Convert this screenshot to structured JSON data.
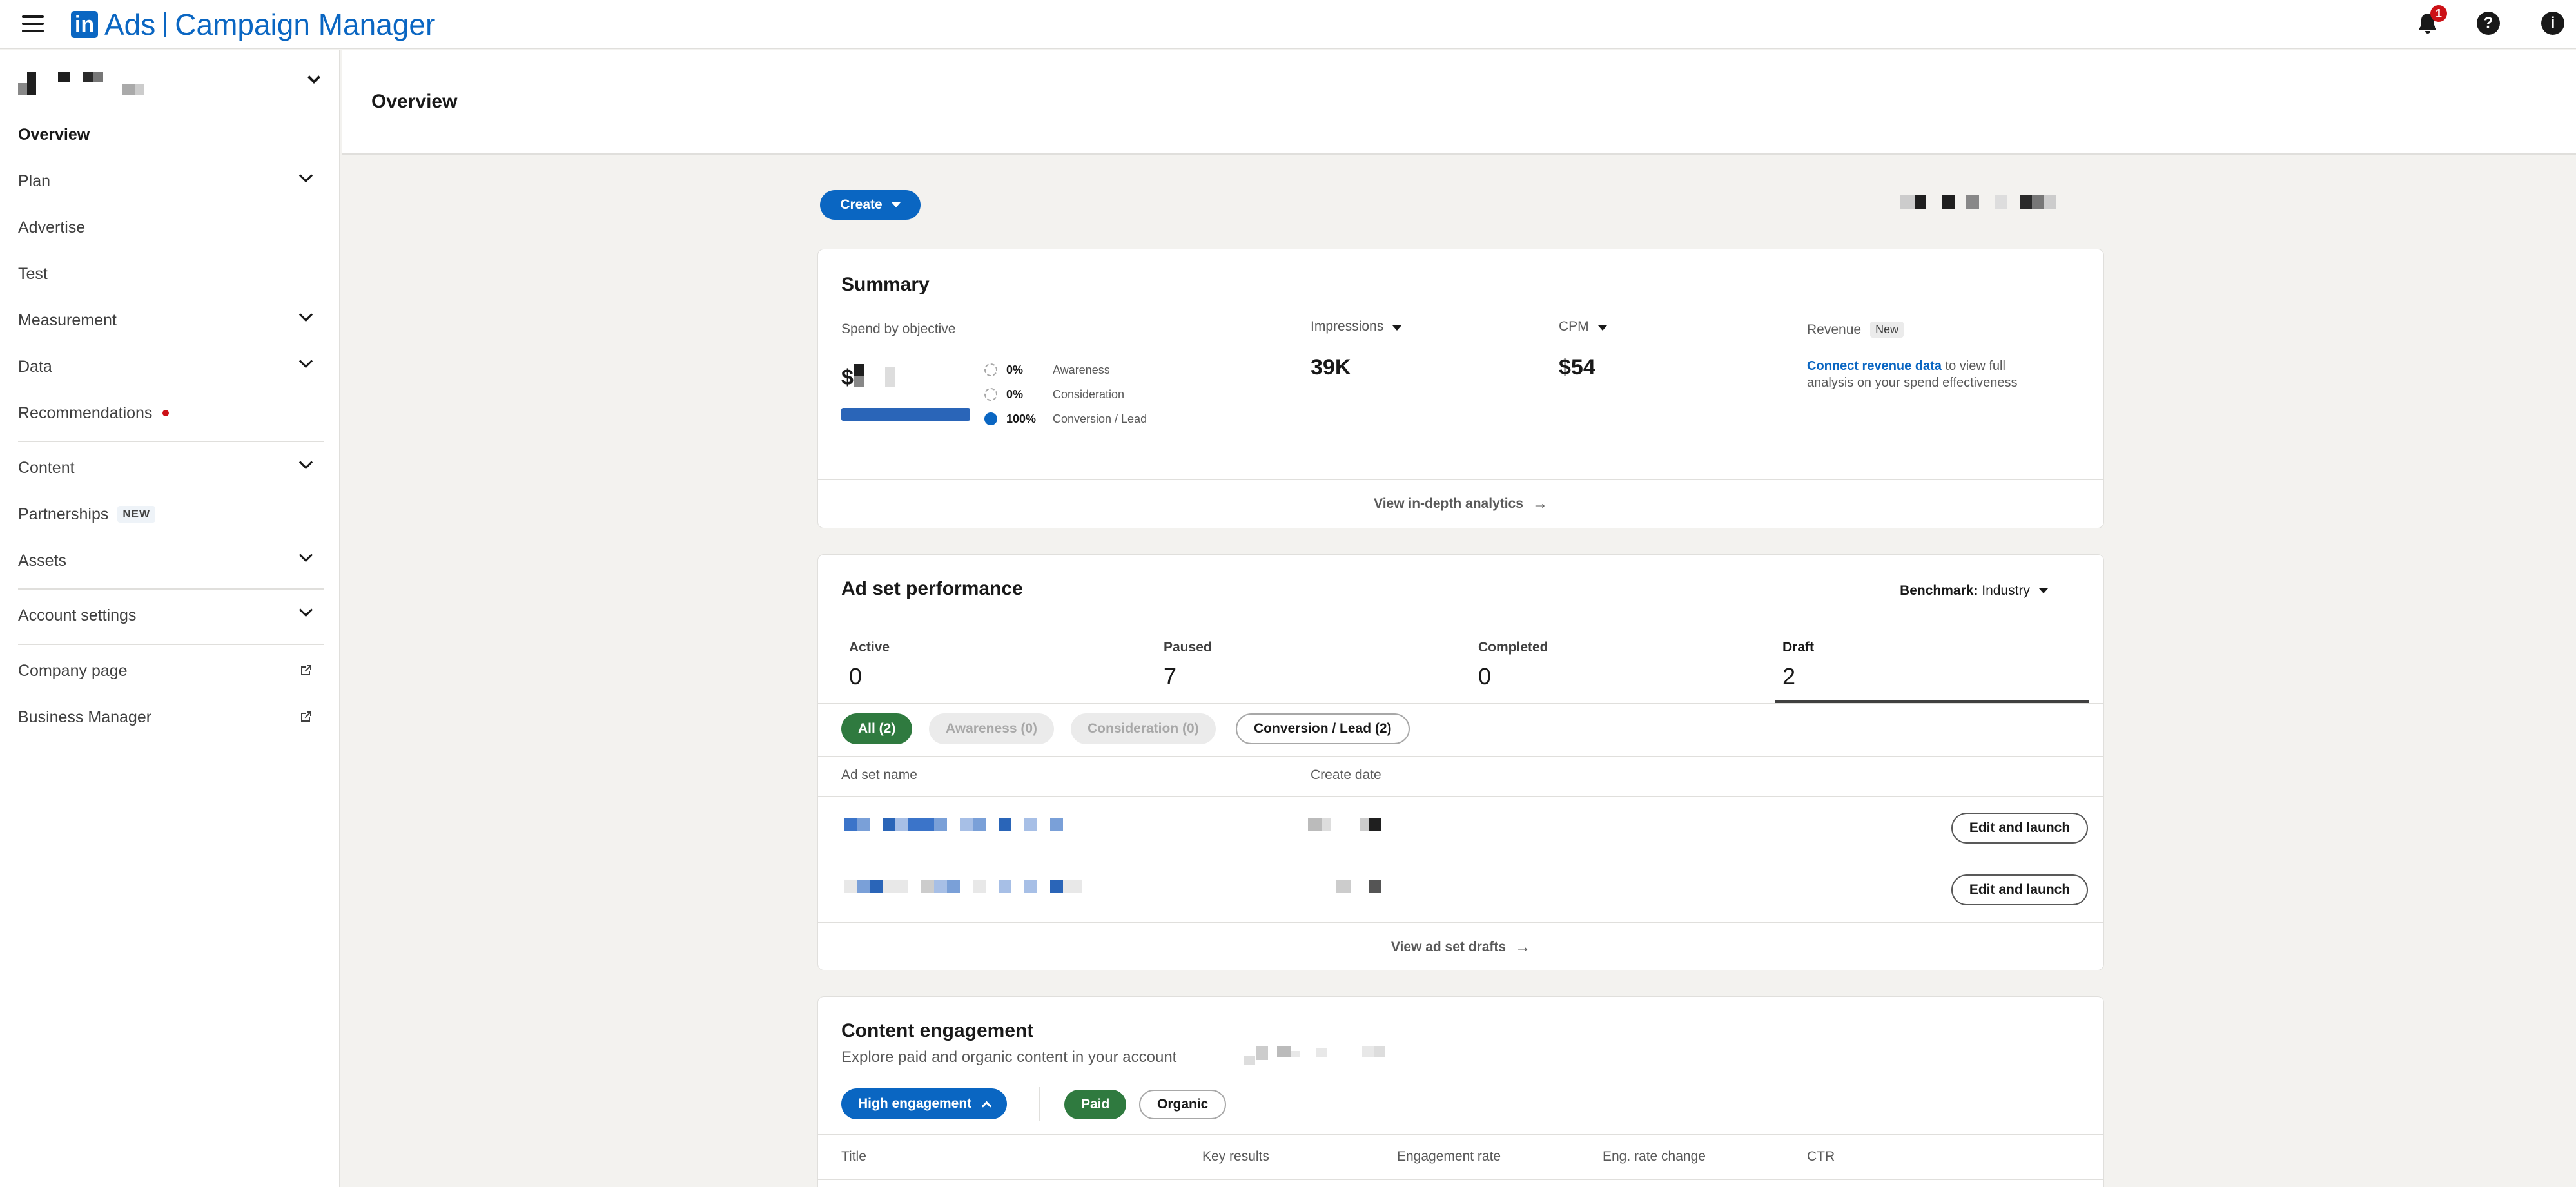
{
  "header": {
    "logo_text": "in",
    "brand_ads": "Ads",
    "brand_product": "Campaign Manager",
    "notification_count": "1",
    "help_glyph": "?",
    "info_glyph": "i"
  },
  "sidebar": {
    "items": [
      {
        "label": "Overview"
      },
      {
        "label": "Plan"
      },
      {
        "label": "Advertise"
      },
      {
        "label": "Test"
      },
      {
        "label": "Measurement"
      },
      {
        "label": "Data"
      },
      {
        "label": "Recommendations"
      },
      {
        "label": "Content"
      },
      {
        "label": "Partnerships",
        "badge": "NEW"
      },
      {
        "label": "Assets"
      },
      {
        "label": "Account settings"
      },
      {
        "label": "Company page"
      },
      {
        "label": "Business Manager"
      }
    ]
  },
  "page": {
    "title": "Overview",
    "create_label": "Create"
  },
  "summary": {
    "title": "Summary",
    "spend_label": "Spend by objective",
    "spend_currency": "$",
    "spend_bar_fraction": 1.0,
    "legend": [
      {
        "pct": "0%",
        "name": "Awareness"
      },
      {
        "pct": "0%",
        "name": "Consideration"
      },
      {
        "pct": "100%",
        "name": "Conversion / Lead"
      }
    ],
    "impressions_label": "Impressions",
    "impressions_value": "39K",
    "cpm_label": "CPM",
    "cpm_value": "$54",
    "revenue_label": "Revenue",
    "revenue_badge": "New",
    "revenue_link": "Connect revenue data",
    "revenue_text_1": "to view full",
    "revenue_text_2": "analysis on your spend effectiveness",
    "footer_link": "View in-depth analytics"
  },
  "adset": {
    "title": "Ad set performance",
    "benchmark_label": "Benchmark:",
    "benchmark_value": "Industry",
    "tabs": [
      {
        "label": "Active",
        "count": "0"
      },
      {
        "label": "Paused",
        "count": "7"
      },
      {
        "label": "Completed",
        "count": "0"
      },
      {
        "label": "Draft",
        "count": "2"
      }
    ],
    "chips": [
      {
        "label": "All (2)"
      },
      {
        "label": "Awareness (0)"
      },
      {
        "label": "Consideration (0)"
      },
      {
        "label": "Conversion / Lead (2)"
      }
    ],
    "col_name": "Ad set name",
    "col_date": "Create date",
    "row_action": "Edit and launch",
    "footer_link": "View ad set drafts"
  },
  "engagement": {
    "title": "Content engagement",
    "subtitle": "Explore paid and organic content in your account",
    "high_btn": "High engagement",
    "paid": "Paid",
    "organic": "Organic",
    "columns": [
      "Title",
      "Key results",
      "Engagement rate",
      "Eng. rate change",
      "CTR"
    ]
  },
  "colors": {
    "brand_blue": "#0a66c2",
    "chip_green": "#2f7a3f",
    "alert_red": "#cc1016",
    "page_bg": "#f3f2ef"
  },
  "icons": [
    "hamburger-icon",
    "linkedin-logo-icon",
    "bell-icon",
    "help-icon",
    "info-icon",
    "chevron-down-icon",
    "external-link-icon",
    "arrow-right-icon",
    "caret-down-icon",
    "chevron-up-icon"
  ]
}
